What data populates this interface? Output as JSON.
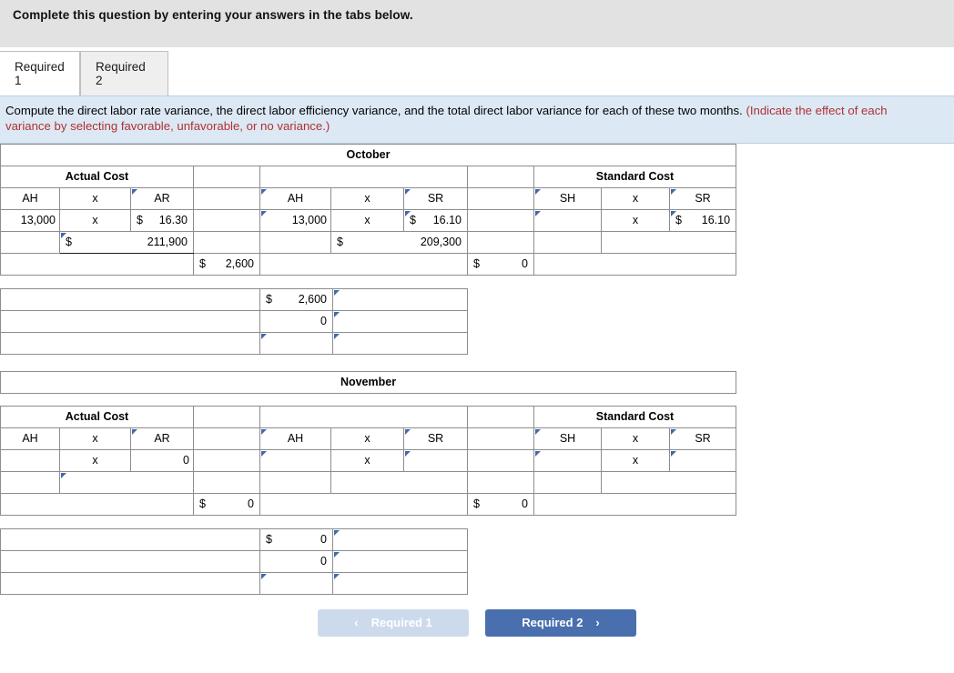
{
  "topbar": {
    "text": "Complete this question by entering your answers in the tabs below."
  },
  "tabs": [
    {
      "label": "Required 1",
      "active": true
    },
    {
      "label": "Required 2",
      "active": false
    }
  ],
  "instruction": {
    "black": "Compute the direct labor rate variance, the direct labor efficiency variance, and the total direct labor variance for each of these two months.",
    "red": "(Indicate the effect of each variance by selecting favorable, unfavorable, or no variance.)"
  },
  "labels": {
    "actual_cost": "Actual Cost",
    "standard_cost": "Standard Cost",
    "ah": "AH",
    "ar": "AR",
    "sh": "SH",
    "sr": "SR",
    "times": "x",
    "dollar": "$"
  },
  "october": {
    "month": "October",
    "actual": {
      "ah_value": "13,000",
      "times": "x",
      "ar_value": "16.30",
      "ar_symbol": "$",
      "total_symbol": "$",
      "total_value": "211,900"
    },
    "middle_variance": {
      "symbol": "$",
      "value": "2,600"
    },
    "flexible": {
      "ah_value": "13,000",
      "times": "x",
      "sr_value": "16.10",
      "sr_symbol": "$",
      "total_symbol": "$",
      "total_value": "209,300"
    },
    "right_variance": {
      "symbol": "$",
      "value": "0"
    },
    "standard": {
      "sh_value": "",
      "times": "x",
      "sr_value": "16.10",
      "sr_symbol": "$",
      "total_value": ""
    },
    "summary_rows": [
      {
        "label": "",
        "symbol": "$",
        "amount": "2,600",
        "effect": ""
      },
      {
        "label": "",
        "symbol": "",
        "amount": "0",
        "effect": ""
      },
      {
        "label": "",
        "symbol": "",
        "amount": "",
        "effect": ""
      }
    ]
  },
  "november": {
    "month": "November",
    "actual": {
      "ah_value": "",
      "times": "x",
      "ar_value": "0",
      "ar_symbol": "",
      "total_symbol": "",
      "total_value": ""
    },
    "middle_variance": {
      "symbol": "$",
      "value": "0"
    },
    "flexible": {
      "ah_value": "",
      "times": "x",
      "sr_value": "",
      "sr_symbol": "",
      "total_symbol": "",
      "total_value": ""
    },
    "right_variance": {
      "symbol": "$",
      "value": "0"
    },
    "standard": {
      "sh_value": "",
      "times": "x",
      "sr_value": "",
      "sr_symbol": "",
      "total_value": ""
    },
    "summary_rows": [
      {
        "label": "",
        "symbol": "$",
        "amount": "0",
        "effect": ""
      },
      {
        "label": "",
        "symbol": "",
        "amount": "0",
        "effect": ""
      },
      {
        "label": "",
        "symbol": "",
        "amount": "",
        "effect": ""
      }
    ]
  },
  "footer": {
    "prev_label": "Required 1",
    "prev_chevron": "‹",
    "next_label": "Required 2",
    "next_chevron": "›"
  },
  "colors": {
    "header_blue": "#88aede",
    "entry_border": "#6f94c4",
    "input_yellow": "#fbf8c8",
    "instruction_bg": "#dce9f5",
    "red_text": "#b03030",
    "button_blue": "#4a6fae",
    "button_disabled": "#ccdaec"
  }
}
